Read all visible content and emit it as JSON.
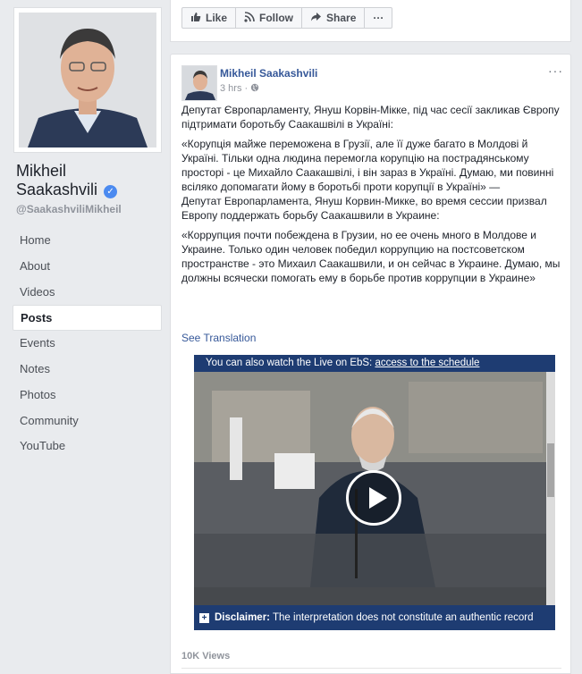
{
  "profile": {
    "name_line1": "Mikheil",
    "name_line2": "Saakashvili",
    "username": "@SaakashviliMikheil"
  },
  "nav": {
    "items": [
      "Home",
      "About",
      "Videos",
      "Posts",
      "Events",
      "Notes",
      "Photos",
      "Community",
      "YouTube"
    ],
    "active": "Posts"
  },
  "actions": {
    "like": "Like",
    "follow": "Follow",
    "share": "Share",
    "more": "···"
  },
  "post": {
    "author": "Mikheil Saakashvili",
    "time": "3 hrs",
    "more": "···",
    "paragraphs": [
      "Депутат Європарламенту, Януш Корвін-Мікке, під час сесії закликав Європу підтримати боротьбу Саакашвілі в Україні:",
      "«Корупція майже переможена в Грузії, але її дуже багато в Молдові й Україні. Тільки одна людина перемогла корупцію на пострадянському просторі - це Михайло Саакашвілі, і він зараз в Україні. Думаю, ми повинні всіляко допомагати йому в боротьбі проти корупції в Україні» —",
      "Депутат Европарламента, Януш Корвин-Микке, во время сессии призвал Европу поддержать борьбу Саакашвили в Украине:",
      "«Коррупция почти побеждена в Грузии, но ее очень много в Молдове и Украине. Только один человек победил коррупцию на постсоветском пространстве - это Михаил Саакашвили, и он сейчас в Украине. Думаю, мы должны всячески помогать ему в борьбе против коррупции в Украине»"
    ],
    "see_translation": "See Translation",
    "views": "10K Views"
  },
  "video": {
    "banner_text": "You can also watch the Live on EbS: ",
    "banner_link": "access to the schedule",
    "disclaimer_label": "Disclaimer:",
    "disclaimer_text": " The interpretation does not constitute an authentic record"
  }
}
